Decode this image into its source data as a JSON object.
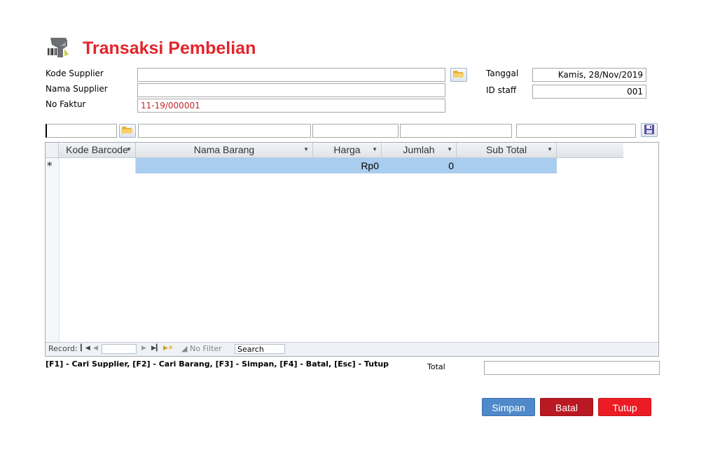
{
  "title": "Transaksi Pembelian",
  "header_fields": {
    "kode_supplier_label": "Kode Supplier",
    "kode_supplier_value": "",
    "nama_supplier_label": "Nama Supplier",
    "nama_supplier_value": "",
    "no_faktur_label": "No Faktur",
    "no_faktur_value": "11-19/000001",
    "tanggal_label": "Tanggal",
    "tanggal_value": "Kamis, 28/Nov/2019",
    "id_staff_label": "ID staff",
    "id_staff_value": "001"
  },
  "entry_row": {
    "barcode": "",
    "nama_barang": "",
    "harga": "",
    "jumlah": "",
    "sub_total": ""
  },
  "grid": {
    "columns": [
      "Kode Barcode",
      "Nama Barang",
      "Harga",
      "Jumlah",
      "Sub Total"
    ],
    "new_row": {
      "marker": "*",
      "kode_barcode": "",
      "nama_barang": "",
      "harga": "Rp0",
      "jumlah": "0",
      "sub_total": ""
    },
    "navigation": {
      "record_label": "Record:",
      "filter_label": "No Filter",
      "search_label": "Search"
    }
  },
  "shortcut_hint": "[F1] - Cari Supplier, [F2] - Cari Barang, [F3] - Simpan, [F4] - Batal, [Esc] - Tutup",
  "total_label": "Total",
  "total_value": "",
  "buttons": {
    "simpan": "Simpan",
    "batal": "Batal",
    "tutup": "Tutup"
  },
  "colors": {
    "title": "#e3242b",
    "simpan": "#4f89c9",
    "batal": "#ba1822",
    "tutup": "#ec1c24",
    "selected_row": "#a9cdee"
  },
  "icons": [
    "barcode-scanner-icon",
    "folder-icon",
    "save-disk-icon"
  ]
}
